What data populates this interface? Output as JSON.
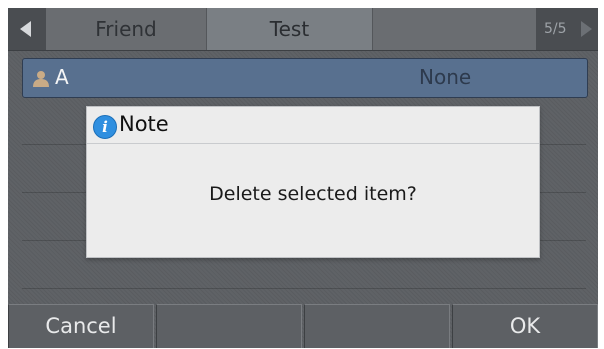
{
  "tabs": {
    "items": [
      {
        "label": "Friend",
        "active": false
      },
      {
        "label": "Test",
        "active": true
      },
      {
        "label": "",
        "active": false
      }
    ],
    "page_indicator": "5/5"
  },
  "contact_row": {
    "icon": "person-icon",
    "name": "A",
    "value": "None"
  },
  "dialog": {
    "icon": "info-icon",
    "icon_glyph": "i",
    "title": "Note",
    "message": "Delete selected item?"
  },
  "softkeys": {
    "left": "Cancel",
    "second": "",
    "third": "",
    "right": "OK"
  },
  "colors": {
    "row_highlight": "#58708f",
    "info_icon": "#2f8fe0",
    "screen_bg": "#5f6266"
  }
}
